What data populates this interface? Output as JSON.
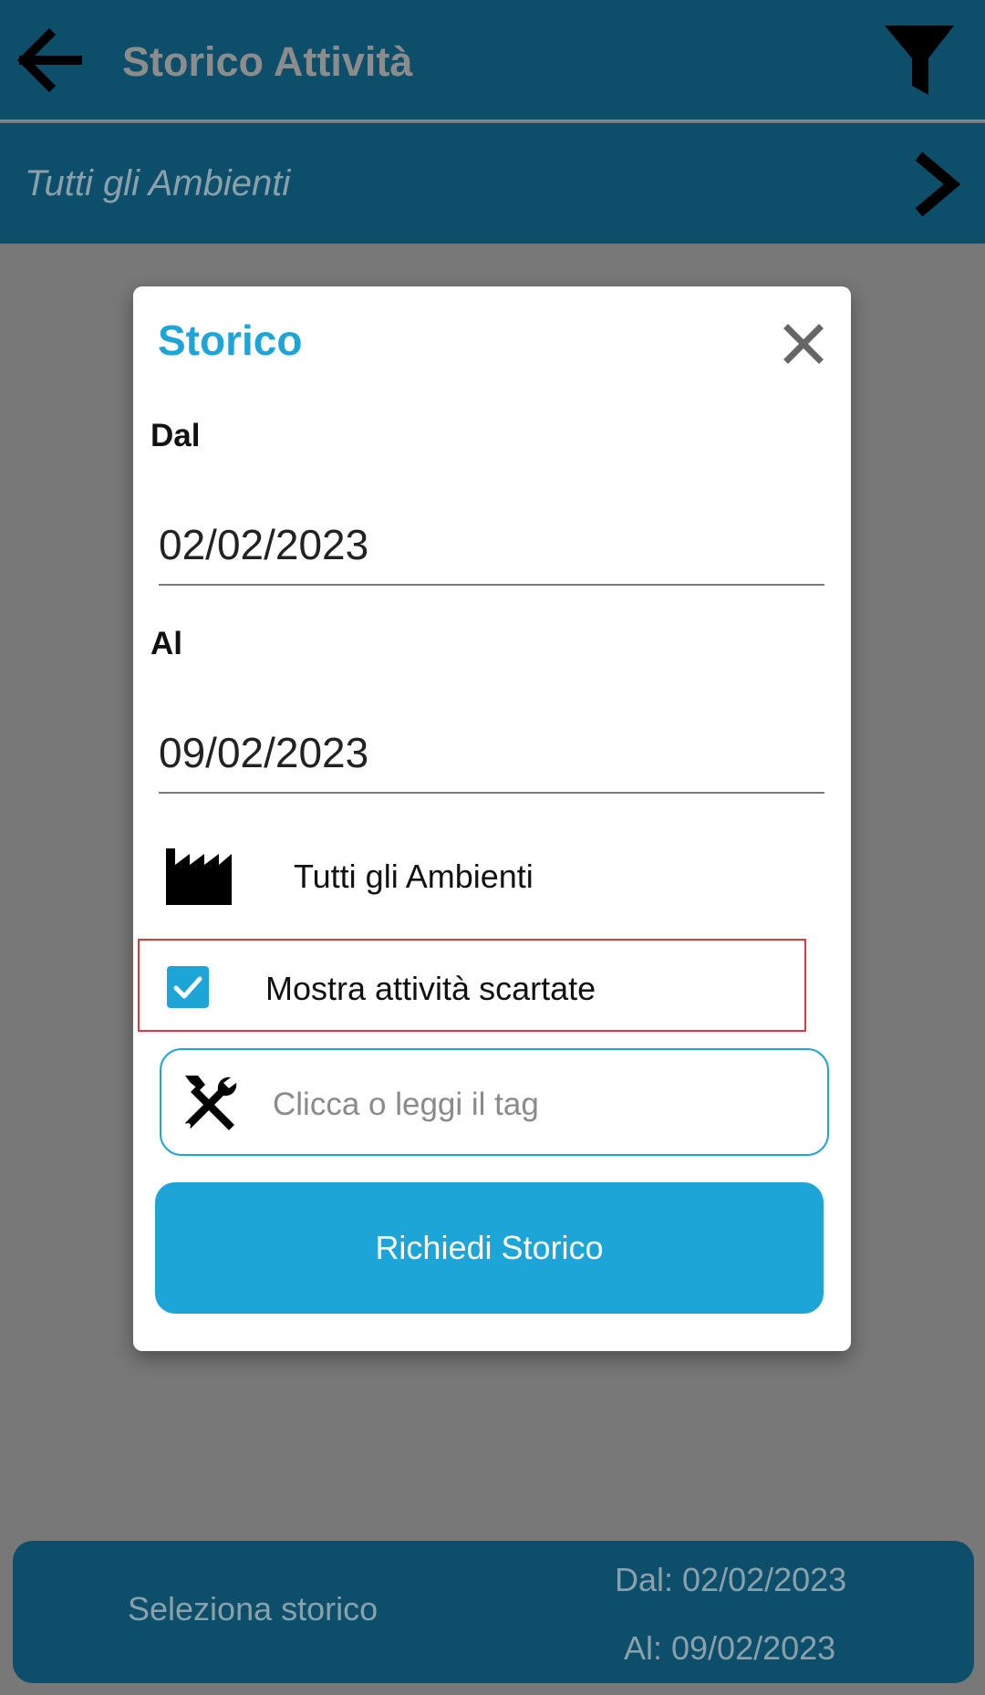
{
  "app_bar": {
    "title": "Storico Attività",
    "back_icon": "arrow-left-icon",
    "filter_icon": "filter-icon"
  },
  "sub_bar": {
    "label": "Tutti gli Ambienti",
    "chevron_icon": "chevron-right-icon"
  },
  "dialog": {
    "title": "Storico",
    "close_icon": "close-icon",
    "from_label": "Dal",
    "from_value": "02/02/2023",
    "to_label": "Al",
    "to_value": "09/02/2023",
    "environment": {
      "icon": "factory-icon",
      "label": "Tutti gli Ambienti"
    },
    "show_discarded": {
      "label": "Mostra attività scartate",
      "checked": true
    },
    "tag_input": {
      "icon": "tools-icon",
      "placeholder": "Clicca o leggi il tag"
    },
    "submit_label": "Richiedi Storico",
    "colors": {
      "accent": "#1ea5d8",
      "highlight_border": "#e3353d"
    }
  },
  "bottom_bar": {
    "label": "Seleziona storico",
    "from_text": "Dal: 02/02/2023",
    "to_text": "Al: 09/02/2023"
  },
  "colors": {
    "primary": "#0d4f6b",
    "overlay": "#787878"
  }
}
